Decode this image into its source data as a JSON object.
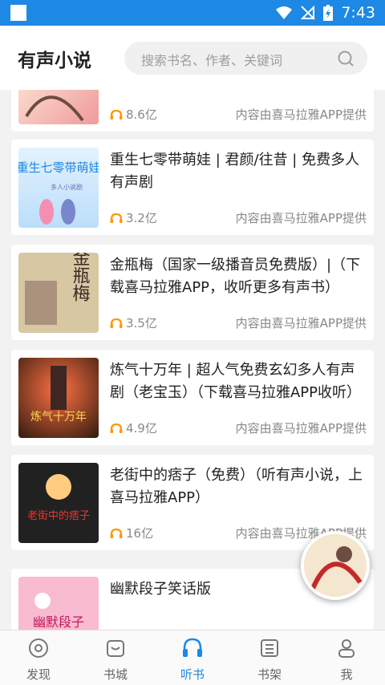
{
  "status_bar": {
    "time": "7:43"
  },
  "header": {
    "title": "有声小说",
    "search_placeholder": "搜索书名、作者、关键词"
  },
  "books": [
    {
      "title": "",
      "plays": "8.6亿",
      "source": "内容由喜马拉雅APP提供",
      "cover_colors": [
        "#fbe9e7",
        "#e57373"
      ]
    },
    {
      "title": "重生七零带萌娃 | 君颜/往昔 | 免费多人有声剧",
      "plays": "3.2亿",
      "source": "内容由喜马拉雅APP提供",
      "cover_text": "重生七零带萌娃",
      "cover_subtext": "多人小说剧",
      "cover_colors": [
        "#bbdefb",
        "#e3f2fd"
      ]
    },
    {
      "title": "金瓶梅（国家一级播音员免费版）|（下载喜马拉雅APP，收听更多有声书）",
      "plays": "3.5亿",
      "source": "内容由喜马拉雅APP提供",
      "cover_text": "金瓶梅",
      "cover_colors": [
        "#d7c7a3",
        "#8d6e63"
      ]
    },
    {
      "title": "炼气十万年 | 超人气免费玄幻多人有声剧（老宝玉）（下载喜马拉雅APP收听）",
      "plays": "4.9亿",
      "source": "内容由喜马拉雅APP提供",
      "cover_text": "炼气十万年",
      "cover_colors": [
        "#bf360c",
        "#311b0e"
      ]
    },
    {
      "title": "老街中的痞子（免费）（听有声小说，上喜马拉雅APP）",
      "plays": "16亿",
      "source": "内容由喜马拉雅APP提供",
      "cover_text": "老街中的痞子",
      "cover_colors": [
        "#212121",
        "#c62828"
      ]
    },
    {
      "title": "幽默段子笑话版",
      "plays": "",
      "source": "",
      "cover_text": "幽默段子",
      "cover_colors": [
        "#f8bbd0",
        "#ffffff"
      ]
    }
  ],
  "nav": [
    {
      "label": "发现",
      "icon": "compass-icon",
      "active": false
    },
    {
      "label": "书城",
      "icon": "bookstore-bag-icon",
      "active": false
    },
    {
      "label": "听书",
      "icon": "headphones-icon",
      "active": true
    },
    {
      "label": "书架",
      "icon": "bookshelf-icon",
      "active": false
    },
    {
      "label": "我",
      "icon": "person-icon",
      "active": false
    }
  ],
  "colors": {
    "accent": "#1e88e5",
    "play_icon": "#ff9800"
  }
}
